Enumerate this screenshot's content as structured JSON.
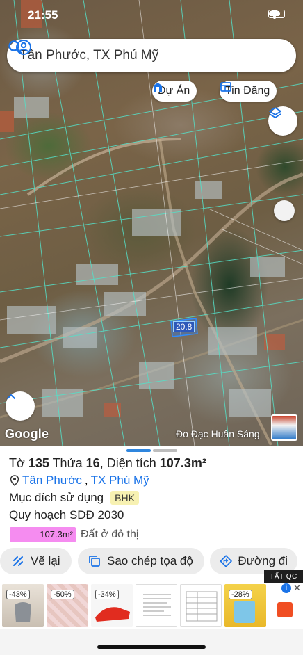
{
  "status_bar": {
    "time": "21:55"
  },
  "search": {
    "query": "Tân Phước, TX Phú Mỹ"
  },
  "chips": {
    "du_an": "Dự Án",
    "tin_dang": "Tin Đăng"
  },
  "map": {
    "plot_label": "20.8",
    "provider": "Google",
    "credit": "Đo Đạc Huân Sáng"
  },
  "parcel": {
    "to_label": "Tờ",
    "to_value": "135",
    "thua_label": "Thửa",
    "thua_value": "16",
    "area_label": "Diện tích",
    "area_value": "107.3m²",
    "ward": "Tân Phước",
    "district": "TX Phú Mỹ",
    "separator": ",",
    "usage_label": "Mục đích sử dụng",
    "usage_code": "BHK",
    "planning_label": "Quy hoạch SDĐ 2030",
    "planning_area": "107.3m²",
    "planning_fraction": 1.0,
    "planning_type": "Đất ở đô thị"
  },
  "actions": {
    "redraw": "Vẽ lại",
    "copy_coords": "Sao chép tọa độ",
    "directions": "Đường đi"
  },
  "ads": {
    "close_all": "TẤT QC",
    "discounts": [
      "-43%",
      "-50%",
      "-34%",
      "-28%"
    ]
  },
  "colors": {
    "accent_blue": "#1a73e8",
    "planning_pink": "#f58cf0",
    "badge_yellow": "#f7f1b2",
    "handle_active": "#2f86de",
    "handle_inactive": "#bdbdbd"
  },
  "icons": {
    "search": "search-icon",
    "pin": "location-pin-icon",
    "layers": "layers-icon",
    "chevron_up": "chevron-up-icon",
    "du_an": "building-icon",
    "tin_dang": "listing-icon",
    "redraw": "redraw-icon",
    "copy": "copy-icon",
    "directions": "directions-icon"
  }
}
